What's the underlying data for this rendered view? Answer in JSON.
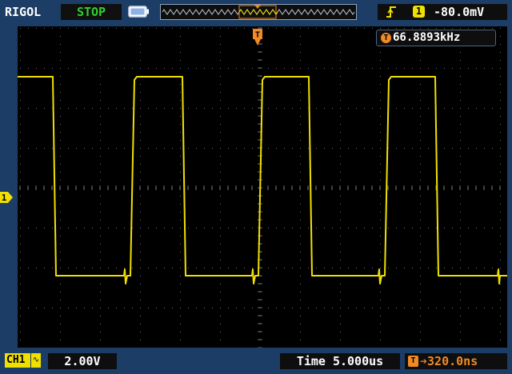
{
  "brand": "RIGOL",
  "status": "STOP",
  "trigger": {
    "source": "1",
    "level": "-80.0mV",
    "slope_icon": "rising-edge-icon"
  },
  "frequency": {
    "icon_label": "T",
    "value": "66.8893kHz"
  },
  "channel": {
    "name": "CH1",
    "coupling_icon": "ac-coupling-icon",
    "coupling_symbol": "∿",
    "scale": "2.00V",
    "marker": "1"
  },
  "timebase": {
    "label": "Time",
    "value": "5.000us"
  },
  "trigger_offset": {
    "icon_label": "T",
    "arrow": "➔",
    "value": "320.0ns"
  },
  "trigger_marker": "T",
  "colors": {
    "trace": "#f0e000",
    "trigger_accent": "#f08a24",
    "status": "#2fd02f",
    "frame": "#1c3d66"
  }
}
